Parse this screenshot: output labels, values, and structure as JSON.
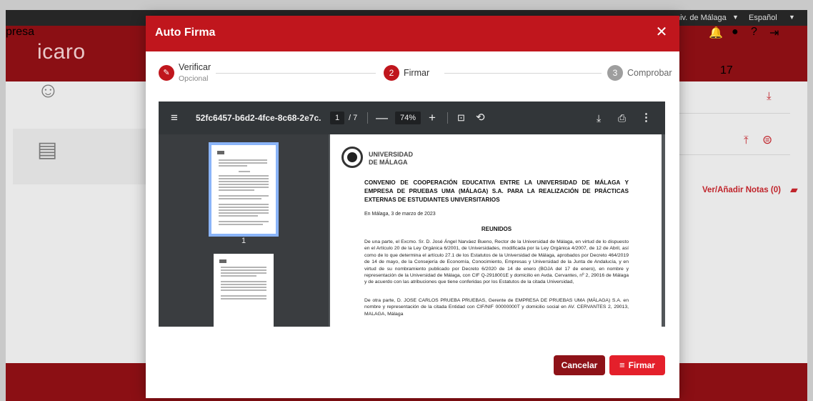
{
  "background": {
    "university": "niv. de Málaga",
    "language": "Español",
    "logo": "icaro",
    "header_text": "presa",
    "notification_count": "17",
    "notes_label": "Ver/Añadir Notas (0)"
  },
  "modal": {
    "title": "Auto Firma",
    "close_icon": "close-icon",
    "stepper": {
      "steps": [
        {
          "number": "",
          "label": "Verificar",
          "sublabel": "Opcional",
          "state": "done",
          "icon": "pencil-icon"
        },
        {
          "number": "2",
          "label": "Firmar",
          "sublabel": "",
          "state": "active"
        },
        {
          "number": "3",
          "label": "Comprobar",
          "sublabel": "",
          "state": "pending"
        }
      ]
    },
    "viewer": {
      "filename": "52fc6457-b6d2-4fce-8c68-2e7c...",
      "page_current": "1",
      "page_separator": "/ 7",
      "zoom": "74%",
      "thumbnail_label": "1"
    },
    "document": {
      "university_line1": "UNIVERSIDAD",
      "university_line2": "DE MÁLAGA",
      "title": "CONVENIO DE COOPERACIÓN EDUCATIVA ENTRE LA UNIVERSIDAD DE MÁLAGA Y EMPRESA DE PRUEBAS UMA (MÁLAGA) S.A. PARA LA REALIZACIÓN DE PRÁCTICAS EXTERNAS DE ESTUDIANTES UNIVERSITARIOS",
      "date": "En Málaga, 3 de marzo de 2023",
      "section": "REUNIDOS",
      "paragraph1": "De una parte, el Excmo. Sr. D. José Ángel Narváez Bueno, Rector de la Universidad de Málaga, en virtud de lo dispuesto en el Artículo 20 de la Ley Orgánica 6/2001, de Universidades, modificada por la Ley Orgánica 4/2007, de 12 de Abril, así como de lo que determina el artículo 27.1 de los Estatutos de la Universidad de Málaga, aprobados por Decreto 464/2019 de 14 de mayo, de la Consejería de Economía, Conocimiento, Empresas y Universidad de la Junta de Andalucía, y en virtud de su nombramiento publicado por Decreto 6/2020 de 14 de enero (BOJA del 17 de enero), en nombre y representación de la Universidad de Málaga, con CIF Q-2918001E y domicilio en Avda. Cervantes, nº 2, 29016 de Málaga y de acuerdo con las atribuciones que tiene conferidas por los Estatutos de la citada Universidad,",
      "paragraph2": "De otra parte, D. JOSE CARLOS PRUEBA PRUEBAS, Gerente de EMPRESA DE PRUEBAS UMA (MÁLAGA) S.A. en nombre y representación de la citada Entidad con CIF/NIF 00000000T y domicilio social en AV. CERVANTES 2, 29013, MALAGA, Málaga"
    },
    "buttons": {
      "cancel": "Cancelar",
      "sign": "Firmar"
    }
  },
  "colors": {
    "primary": "#c0161d",
    "dark_red": "#8e1218",
    "accent_red": "#e4202b",
    "viewer_toolbar": "#323639",
    "thumbnail_highlight": "#8ab4f8"
  }
}
